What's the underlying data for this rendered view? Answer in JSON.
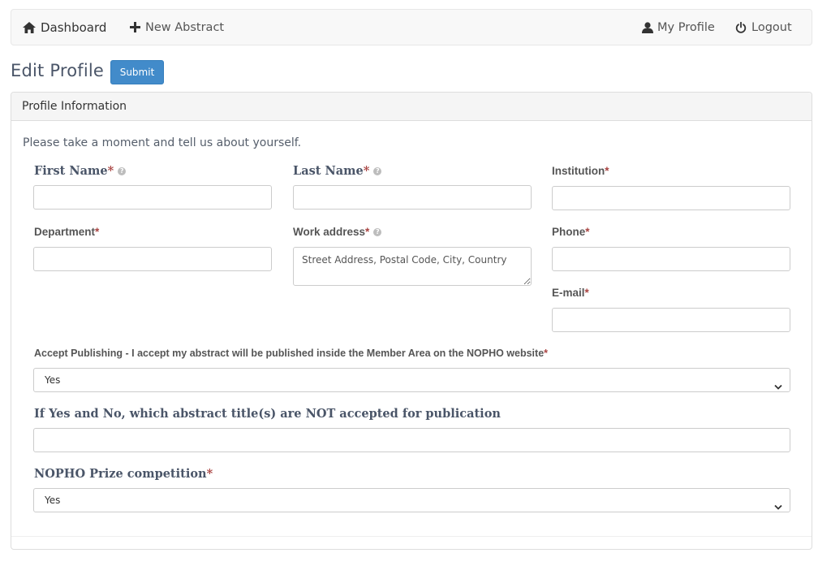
{
  "nav": {
    "dashboard": "Dashboard",
    "new_abstract": "New Abstract",
    "my_profile": "My Profile",
    "logout": "Logout"
  },
  "page": {
    "title": "Edit Profile",
    "submit_label": "Submit"
  },
  "panel": {
    "heading": "Profile Information",
    "intro": "Please take a moment and tell us about yourself."
  },
  "fields": {
    "first_name": {
      "label": "First Name",
      "value": ""
    },
    "last_name": {
      "label": "Last Name",
      "value": ""
    },
    "institution": {
      "label": "Institution",
      "value": ""
    },
    "department": {
      "label": "Department",
      "value": ""
    },
    "work_address": {
      "label": "Work address",
      "placeholder": "Street Address, Postal Code, City, Country"
    },
    "phone": {
      "label": "Phone",
      "value": ""
    },
    "email": {
      "label": "E-mail",
      "value": ""
    },
    "accept_publishing": {
      "label": "Accept Publishing - I accept my abstract will be published inside the Member Area on the NOPHO website",
      "selected": "Yes"
    },
    "not_accepted_titles": {
      "label": "If Yes and No, which abstract title(s) are NOT accepted for publication",
      "value": ""
    },
    "prize": {
      "label": "NOPHO Prize competition",
      "selected": "Yes"
    }
  },
  "required_mark": "*",
  "help_mark": "?",
  "colors": {
    "primary": "#428bca",
    "required": "#a94442"
  },
  "icons": [
    "home-icon",
    "plus-icon",
    "user-icon",
    "power-icon",
    "help-icon",
    "chevron-down-icon"
  ]
}
